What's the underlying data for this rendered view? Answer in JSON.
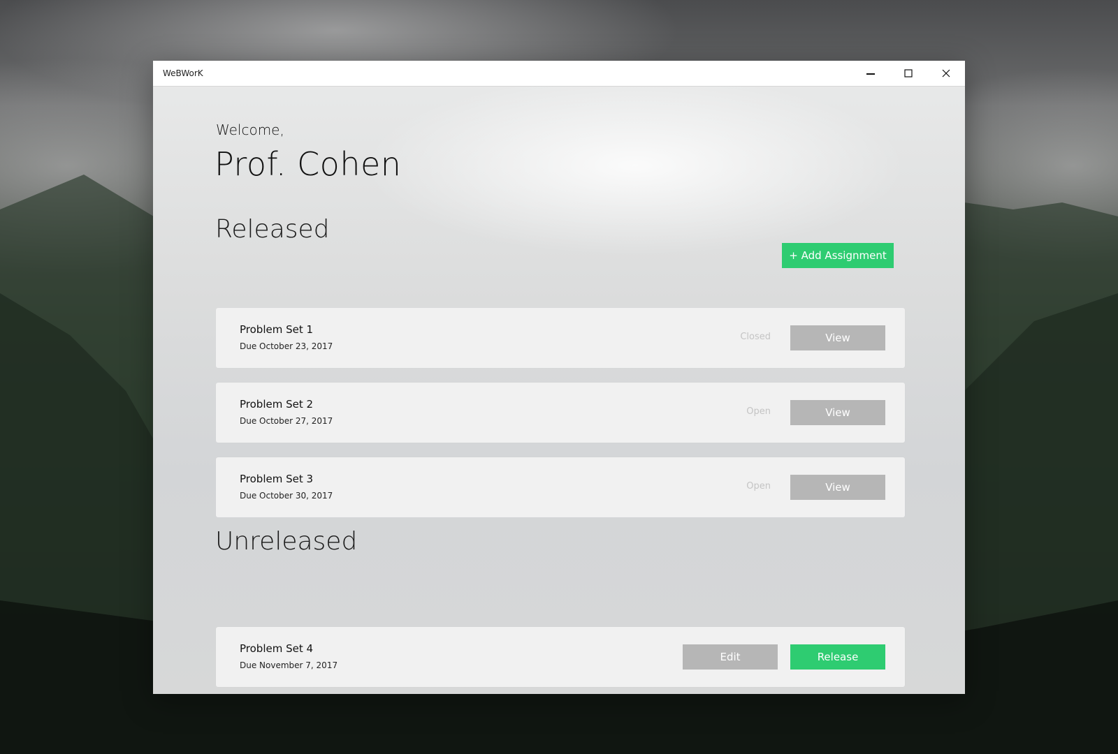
{
  "app": {
    "title": "WeBWorK"
  },
  "header": {
    "welcome": "Welcome,",
    "name": "Prof. Cohen"
  },
  "released": {
    "title": "Released",
    "add_button": "+ Add Assignment",
    "items": [
      {
        "name": "Problem Set 1",
        "due": "Due October 23, 2017",
        "status": "Closed",
        "action": "View"
      },
      {
        "name": "Problem Set 2",
        "due": "Due October 27, 2017",
        "status": "Open",
        "action": "View"
      },
      {
        "name": "Problem Set 3",
        "due": "Due October 30, 2017",
        "status": "Open",
        "action": "View"
      }
    ]
  },
  "unreleased": {
    "title": "Unreleased",
    "items": [
      {
        "name": "Problem Set 4",
        "due": "Due November 7, 2017",
        "edit": "Edit",
        "release": "Release"
      }
    ]
  },
  "colors": {
    "accent_green": "#2ecc71",
    "button_gray": "#b6b6b6",
    "card_bg": "#f1f1f1"
  },
  "icons": {
    "minimize": "minimize-icon",
    "maximize": "maximize-icon",
    "close": "close-icon"
  }
}
